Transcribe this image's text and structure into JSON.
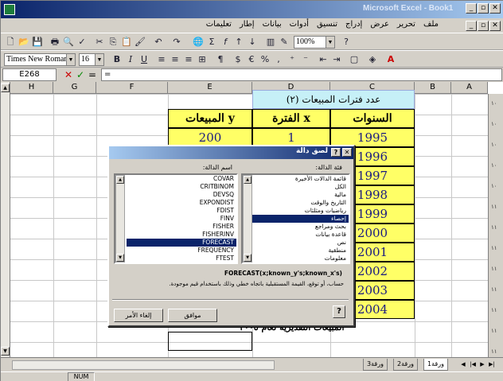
{
  "window": {
    "title": "Microsoft Excel - Book1",
    "buttons": [
      "_",
      "▫",
      "✕"
    ]
  },
  "menu": {
    "items": [
      "ملف",
      "تحرير",
      "عرض",
      "إدراج",
      "تنسيق",
      "أدوات",
      "بيانات",
      "إطار",
      "تعليمات"
    ]
  },
  "toolbar": {
    "zoom": "100%",
    "font_name": "Times New Roman",
    "font_size": "16",
    "bold": "B",
    "italic": "I",
    "underline": "U"
  },
  "formula_bar": {
    "name_box": "E268",
    "content": "="
  },
  "columns": [
    "H",
    "G",
    "F",
    "E",
    "D",
    "C",
    "B",
    "A"
  ],
  "sheet": {
    "table_title": "(٢) عدد فترات المبيعات",
    "headers": {
      "sales": "المبيعات y",
      "period": "الفترة x",
      "years": "السنوات"
    },
    "first_row": {
      "sales": "200",
      "period": "1"
    },
    "years": [
      "1995",
      "1996",
      "1997",
      "1998",
      "1999",
      "2000",
      "2001",
      "2002",
      "2003",
      "2004"
    ],
    "forecast_label": "المبيعات التقديرية لعام ٢٠٠٥"
  },
  "dialog": {
    "title": "لصق دالة",
    "category_label": "فئة الدالة:",
    "name_label": "اسم الدالة:",
    "categories": [
      "قائمة الدالات الأخيرة",
      "الكل",
      "مالية",
      "التاريخ والوقت",
      "رياضيات ومثلثات",
      "إحصاء",
      "بحث ومراجع",
      "قاعدة بيانات",
      "نص",
      "منطقية",
      "معلومات"
    ],
    "selected_category": "إحصاء",
    "functions": [
      "COVAR",
      "CRITBINOM",
      "DEVSQ",
      "EXPONDIST",
      "FDIST",
      "FINV",
      "FISHER",
      "FISHERINV",
      "FORECAST",
      "FREQUENCY",
      "FTEST"
    ],
    "selected_function": "FORECAST",
    "syntax": "FORECAST(x;known_y's;known_x's)",
    "description": "حساب، أو توقع، القيمة المستقبلية باتجاه خطي وذلك باستخدام قيم موجودة.",
    "ok": "موافق",
    "cancel": "إلغاء الأمر",
    "help": "?"
  },
  "sheet_tabs": [
    "ورقة1",
    "ورقة2",
    "ورقة3"
  ],
  "status": {
    "mode": "NUM"
  }
}
